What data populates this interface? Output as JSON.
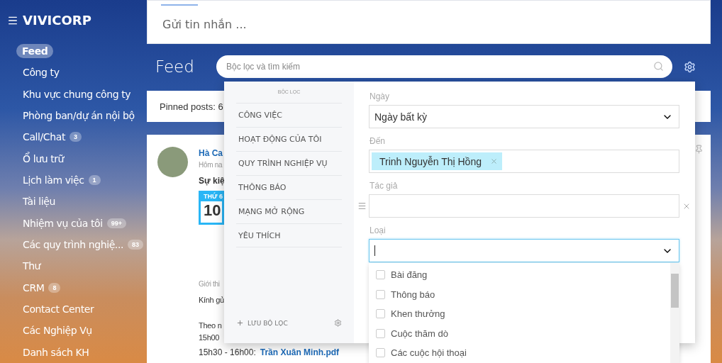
{
  "sidebar": {
    "brand": "VIVICORP",
    "items": [
      {
        "label": "Feed",
        "selected": true
      },
      {
        "label": "Công ty",
        "selected": false
      },
      {
        "label": "Khu vực chung công ty",
        "selected": false
      },
      {
        "label": "Phòng ban/dự án nội bộ",
        "selected": false
      },
      {
        "label": "Call/Chat",
        "badge": "3",
        "selected": false
      },
      {
        "label": "Ổ lưu trữ",
        "selected": false
      },
      {
        "label": "Lịch làm việc",
        "badge": "1",
        "selected": false
      },
      {
        "label": "Tài liệu",
        "selected": false
      },
      {
        "label": "Nhiệm vụ của tôi",
        "badge": "99+",
        "selected": false
      },
      {
        "label": "Các quy trình nghiệ...",
        "badge": "83",
        "selected": false
      },
      {
        "label": "Thư",
        "selected": false
      },
      {
        "label": "CRM",
        "badge": "8",
        "selected": false
      },
      {
        "label": "Contact Center",
        "selected": false
      },
      {
        "label": "Các Nghiệp Vụ",
        "selected": false
      },
      {
        "label": "Danh sách KH",
        "selected": false
      }
    ]
  },
  "composer": {
    "placeholder": "Gửi tin nhắn ..."
  },
  "feed": {
    "title": "Feed",
    "search": {
      "placeholder": "Bộc lọc và tìm kiếm"
    },
    "pinned": "Pinned posts: 6"
  },
  "post": {
    "author": "Hà Ca",
    "time": "Hôm na",
    "title": "Sự kiệ",
    "calendar": {
      "weekday": "THỨ 6",
      "day": "10"
    },
    "intro": "Giới thi",
    "greeting": "Kính gủ",
    "lines": [
      "Theo n",
      "15h00"
    ],
    "attachment": {
      "prefix": "15h30 - 16h00:",
      "file": "Trần Xuân Minh.pdf"
    }
  },
  "filter_panel": {
    "heading": "BỘC LỌC",
    "presets": [
      "CÔNG VIỆC",
      "HOẠT ĐỘNG CỦA TÔI",
      "QUY TRÌNH NGHIỆP VỤ",
      "THÔNG BÁO",
      "MẠNG MỞ RỘNG",
      "YÊU THÍCH"
    ],
    "save": "LƯU BỘ LỌC",
    "fields": [
      {
        "kind": "select",
        "label": "Ngày",
        "value": "Ngày bất kỳ",
        "focused": false
      },
      {
        "kind": "tags",
        "label": "Đến",
        "tags": [
          "Trinh Nguyễn Thị Hồng"
        ],
        "focused": false
      },
      {
        "kind": "text",
        "label": "Tác giả",
        "focused": false
      },
      {
        "kind": "select",
        "label": "Loại",
        "focused": true,
        "open": true,
        "options": [
          {
            "label": "Bài đăng",
            "checked": false
          },
          {
            "label": "Thông báo",
            "checked": false
          },
          {
            "label": "Khen thưởng",
            "checked": false
          },
          {
            "label": "Cuộc thăm dò",
            "checked": false
          },
          {
            "label": "Các cuộc hội thoại",
            "checked": false
          }
        ]
      }
    ]
  }
}
